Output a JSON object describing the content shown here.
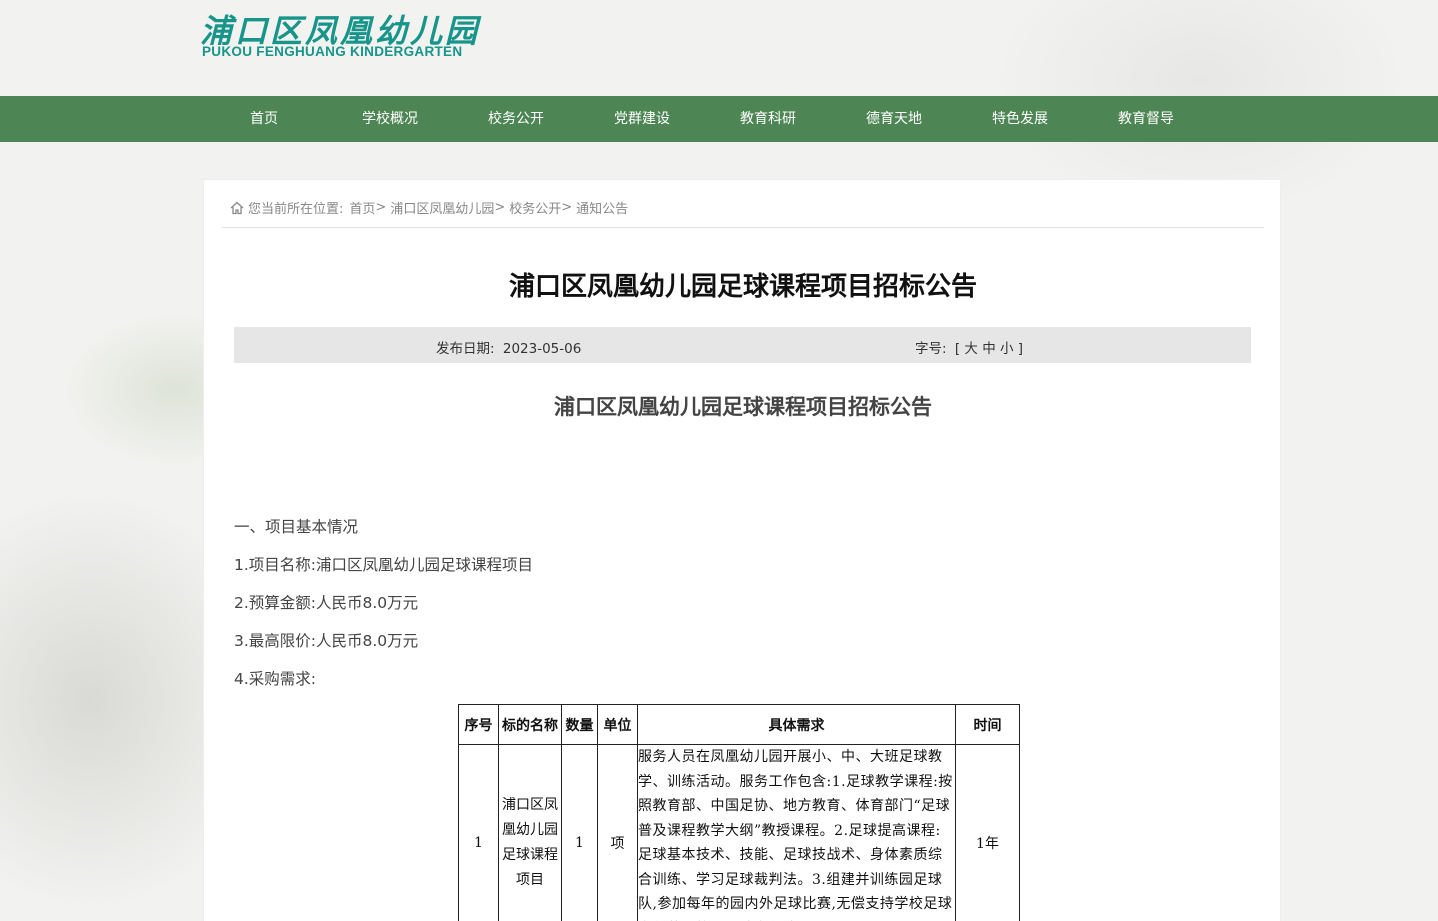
{
  "logo": {
    "cn": "浦口区凤凰幼儿园",
    "en": "PUKOU FENGHUANG KINDERGARTEN"
  },
  "nav": {
    "items": [
      "首页",
      "学校概况",
      "校务公开",
      "党群建设",
      "教育科研",
      "德育天地",
      "特色发展",
      "教育督导"
    ]
  },
  "breadcrumb": {
    "prefix": "您当前所在位置:",
    "items": [
      "首页",
      "浦口区凤凰幼儿园",
      "校务公开",
      "通知公告"
    ],
    "separator": ">"
  },
  "article": {
    "title": "浦口区凤凰幼儿园足球课程项目招标公告",
    "date_label": "发布日期:",
    "date": "2023-05-06",
    "font_size_label": "字号:",
    "font_size_options": "[ 大 中 小 ]",
    "subtitle": "浦口区凤凰幼儿园足球课程项目招标公告",
    "paragraphs": [
      "一、项目基本情况",
      "1.项目名称:浦口区凤凰幼儿园足球课程项目",
      "2.预算金额:人民币8.0万元",
      "3.最高限价:人民币8.0万元",
      "4.采购需求:"
    ]
  },
  "requirements_table": {
    "headers": [
      "序号",
      "标的名称",
      "数量",
      "单位",
      "具体需求",
      "时间"
    ],
    "rows": [
      {
        "index": "1",
        "name": "浦口区凤凰幼儿园足球课程项目",
        "quantity": "1",
        "unit": "项",
        "description": "服务人员在凤凰幼儿园开展小、中、大班足球教学、训练活动。服务工作包含:1.足球教学课程:按照教育部、中国足协、地方教育、体育部门“足球普及课程教学大纲”教授课程。2.足球提高课程:足球基本技术、技能、足球技战术、身体素质综合训练、学习足球裁判法。3.组建并训练园足球队,参加每年的园内外足球比赛,无偿支持学校足球文化节及校园足球文化建设工作。",
        "time": "1年"
      }
    ]
  },
  "colors": {
    "nav_bg": "#4d8654",
    "logo": "#17958a",
    "meta_bg": "#e6e6e6"
  }
}
